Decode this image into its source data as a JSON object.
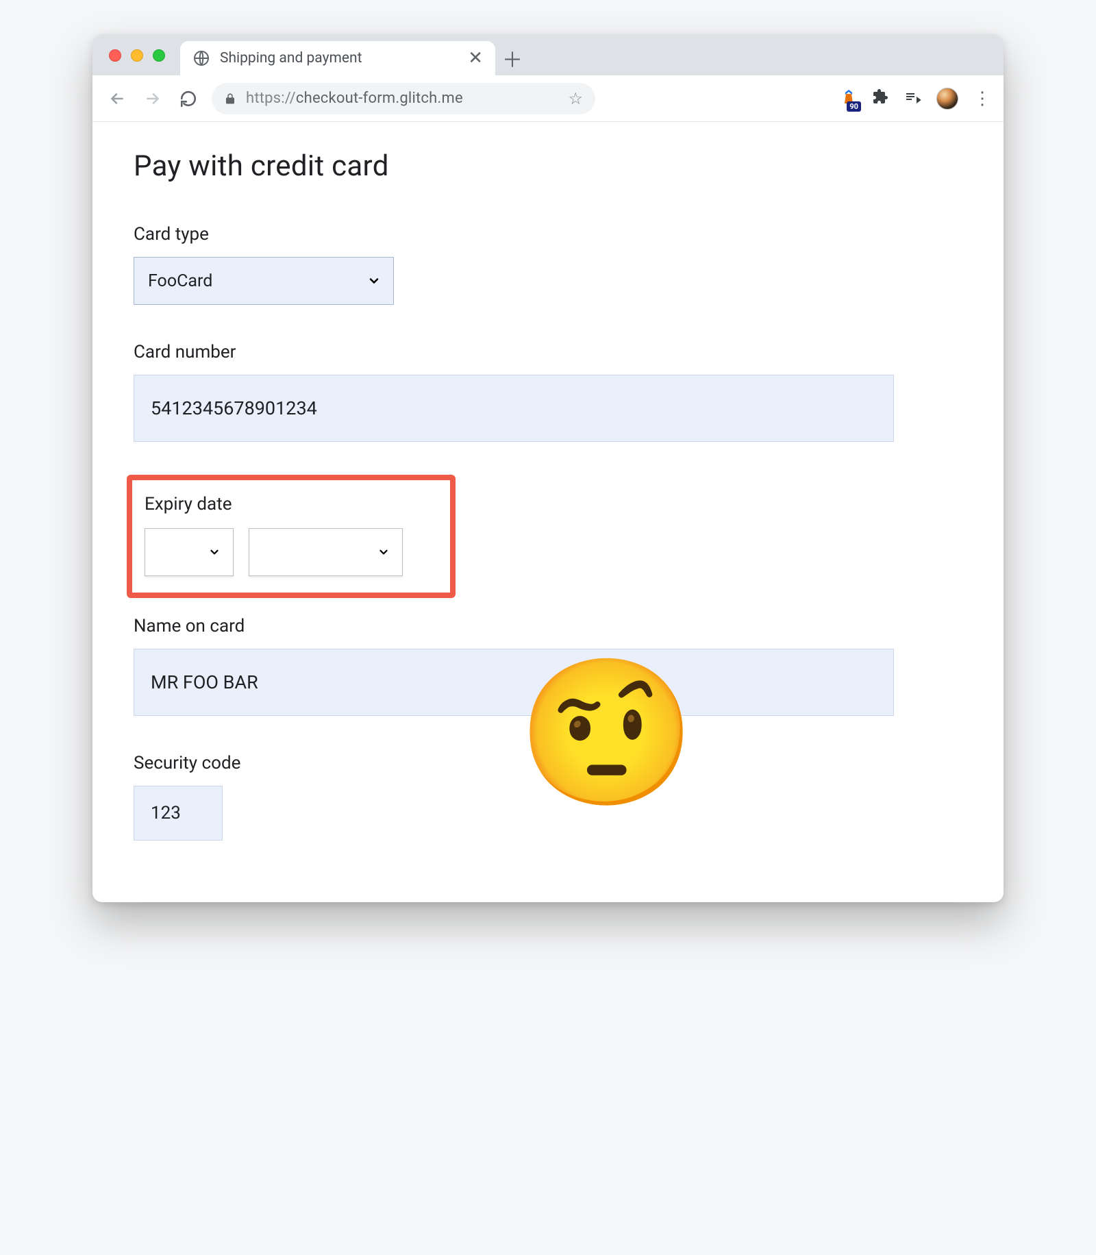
{
  "window": {
    "tab_title": "Shipping and payment",
    "new_tab_icon": "plus-icon"
  },
  "toolbar": {
    "url_scheme": "https://",
    "url_host": "checkout-form.glitch.me",
    "extension_badge": "90"
  },
  "page": {
    "heading": "Pay with credit card",
    "fields": {
      "card_type": {
        "label": "Card type",
        "value": "FooCard"
      },
      "card_number": {
        "label": "Card number",
        "value": "5412345678901234"
      },
      "expiry": {
        "label": "Expiry date",
        "month": "",
        "year": ""
      },
      "name_on_card": {
        "label": "Name on card",
        "value": "MR FOO BAR"
      },
      "security_code": {
        "label": "Security code",
        "value": "123"
      }
    },
    "annotation_emoji": "🤨"
  }
}
